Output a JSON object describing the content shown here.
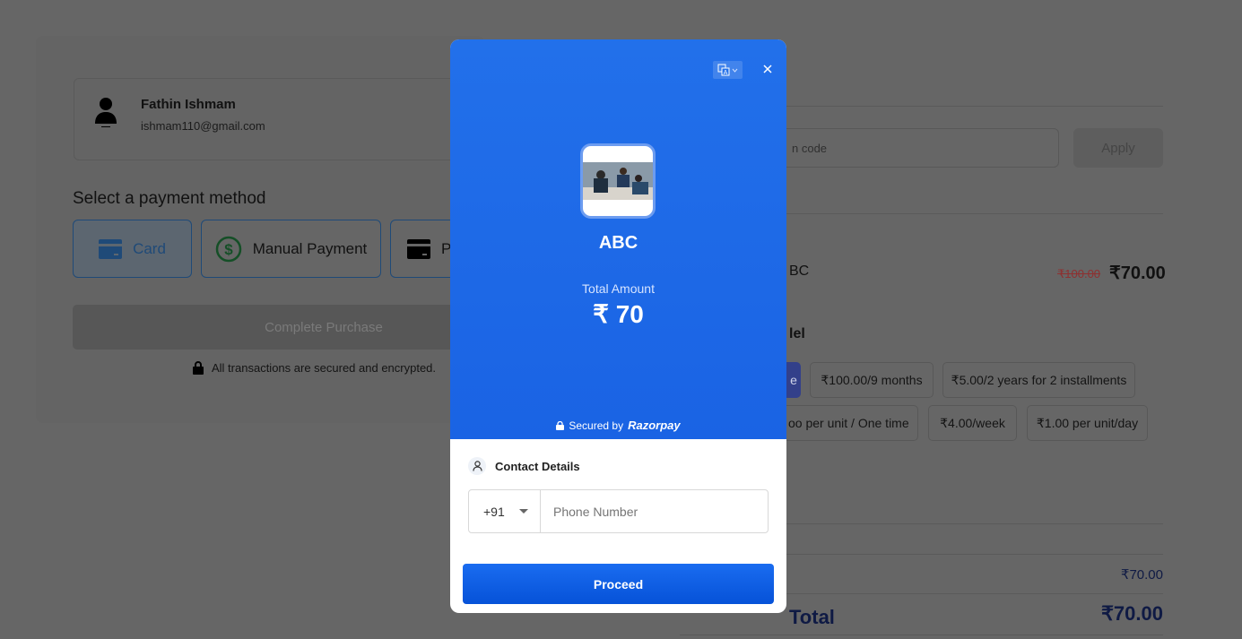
{
  "user": {
    "name": "Fathin Ishmam",
    "email": "ishmam110@gmail.com"
  },
  "payment": {
    "heading": "Select a payment method",
    "methods": [
      {
        "label": "Card",
        "icon": "credit-card-icon"
      },
      {
        "label": "Manual Payment",
        "icon": "dollar-circle-icon"
      },
      {
        "label": "P",
        "icon": "card-icon"
      }
    ],
    "complete_label": "Complete Purchase",
    "secure_note": "All transactions are secured and encrypted."
  },
  "coupon": {
    "placeholder_fragment": "n code",
    "apply_label": "Apply"
  },
  "item": {
    "name_fragment": "BC",
    "old_price": "₹100.00",
    "price": "₹70.00"
  },
  "pricing": {
    "heading_fragment": "lel",
    "options": [
      "e",
      "₹100.00/9 months",
      "₹5.00/2 years for 2 installments",
      "oo per unit / One time",
      "₹4.00/week",
      "₹1.00 per unit/day"
    ]
  },
  "summary": {
    "subtotal": "₹70.00",
    "total_label": "Total",
    "total": "₹70.00"
  },
  "modal": {
    "merchant": "ABC",
    "amount_label": "Total Amount",
    "amount": "₹ 70",
    "secured_by": "Secured by",
    "brand": "Razorpay",
    "contact_heading": "Contact Details",
    "country_code": "+91",
    "phone_placeholder": "Phone Number",
    "proceed_label": "Proceed",
    "accent": "#1a63e4"
  }
}
